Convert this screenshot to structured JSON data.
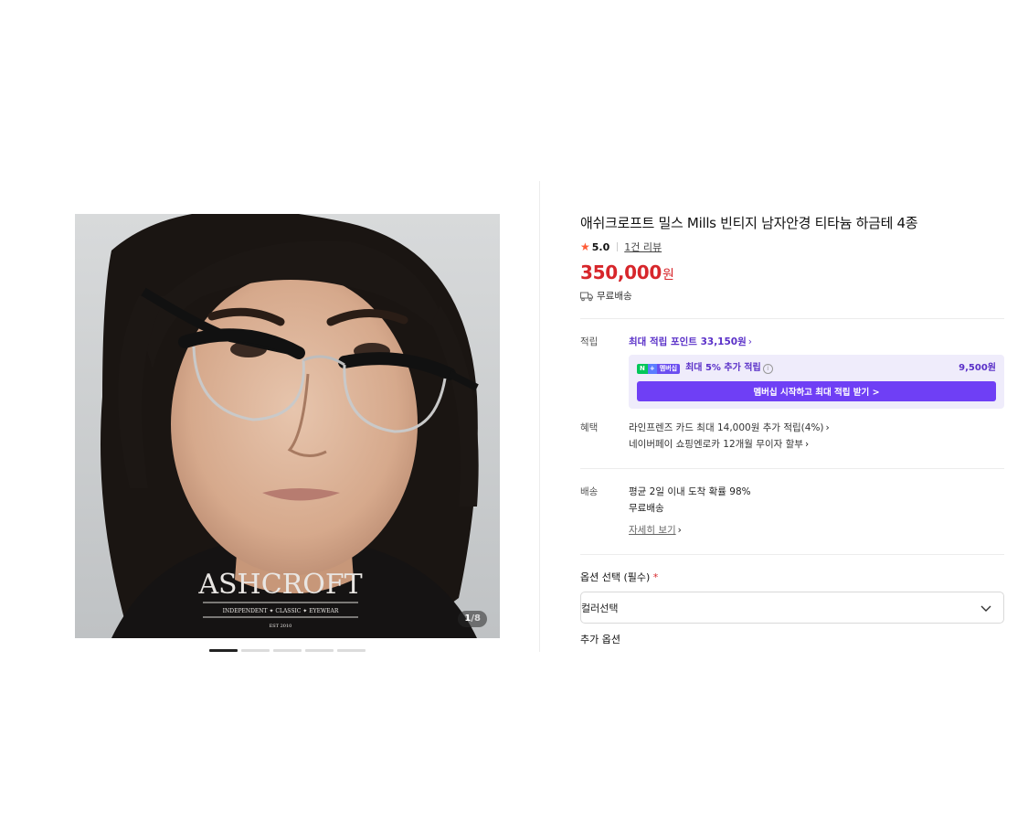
{
  "gallery": {
    "brand_logo": "ASHCROFT",
    "brand_tagline": "INDEPENDENT ✦ CLASSIC ✦ EYEWEAR",
    "brand_est": "EST 2010",
    "counter_current": "1",
    "counter_total": "/8",
    "dot_count": 5,
    "active_dot": 0
  },
  "product": {
    "title": "애쉬크로프트 밀스 Mills 빈티지 남자안경 티타늄 하금테 4종",
    "rating": "5.0",
    "review_link": "1건 리뷰",
    "price": "350,000",
    "price_unit": "원",
    "shipping": "무료배송"
  },
  "points": {
    "label": "적립",
    "max_points_link": "최대 적립 포인트 33,150원",
    "membership_badge": {
      "n": "N",
      "plus": "+",
      "text": "멤버십"
    },
    "membership_text": "최대 5% 추가 적립",
    "membership_amount": "9,500원",
    "membership_button": "멤버십 시작하고 최대 적립 받기 >"
  },
  "benefits": {
    "label": "혜택",
    "items": [
      "라인프렌즈 카드 최대 14,000원 추가 적립(4%)",
      "네이버페이 쇼핑엔로카 12개월 무이자 할부"
    ]
  },
  "delivery": {
    "label": "배송",
    "line1": "평균 2일 이내 도착 확률 98%",
    "line2": "무료배송",
    "detail_link": "자세히 보기"
  },
  "options": {
    "title": "옵션 선택 (필수)",
    "required_mark": "*",
    "select_value": "컬러선택",
    "next_section_cut": "추가 옵션"
  },
  "colors": {
    "price_red": "#d7262b",
    "naver_purple": "#6f3ff5",
    "star": "#ff5b36"
  }
}
